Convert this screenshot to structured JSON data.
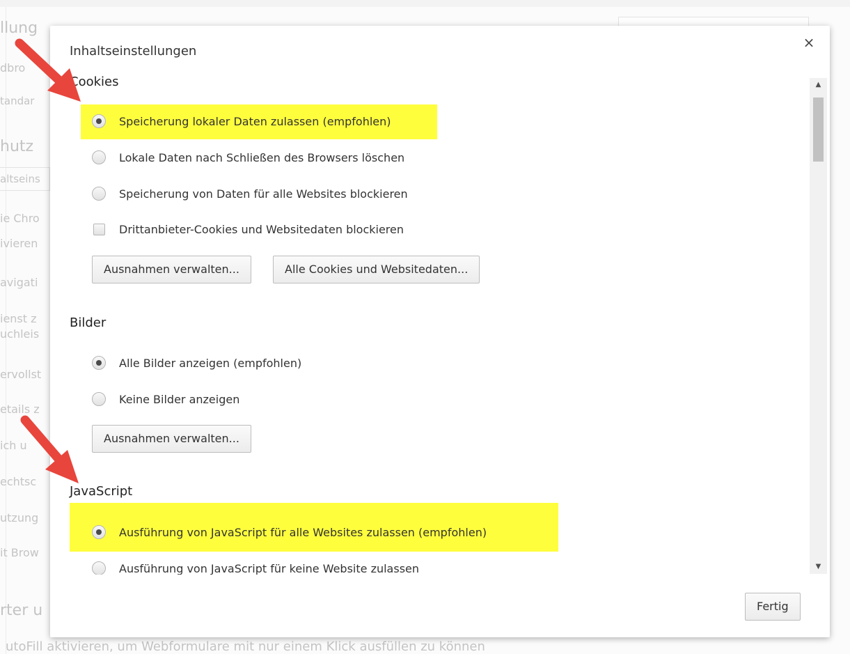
{
  "background": {
    "fragments": [
      "llung",
      "dbro",
      "tandar",
      "hutz",
      "altseins",
      "ie Chro",
      "ivieren",
      "avigati",
      "ienst z",
      "uchleis",
      "ervollst",
      "etails z",
      "ich u",
      "echtsc",
      "utzung",
      "it Brow",
      "rter u"
    ],
    "footer_text": "utoFill aktivieren, um Webformulare mit nur einem Klick ausfüllen zu können"
  },
  "dialog": {
    "title": "Inhaltseinstellungen",
    "close_label": "×",
    "done_label": "Fertig"
  },
  "cookies": {
    "title": "Cookies",
    "options": [
      {
        "label": "Speicherung lokaler Daten zulassen (empfohlen)",
        "checked": true
      },
      {
        "label": "Lokale Daten nach Schließen des Browsers löschen",
        "checked": false
      },
      {
        "label": "Speicherung von Daten für alle Websites blockieren",
        "checked": false
      }
    ],
    "checkbox_label": "Drittanbieter-Cookies und Websitedaten blockieren",
    "checkbox_checked": false,
    "manage_exceptions_label": "Ausnahmen verwalten...",
    "all_cookies_label": "Alle Cookies und Websitedaten..."
  },
  "images": {
    "title": "Bilder",
    "options": [
      {
        "label": "Alle Bilder anzeigen (empfohlen)",
        "checked": true
      },
      {
        "label": "Keine Bilder anzeigen",
        "checked": false
      }
    ],
    "manage_exceptions_label": "Ausnahmen verwalten..."
  },
  "javascript": {
    "title": "JavaScript",
    "options": [
      {
        "label": "Ausführung von JavaScript für alle Websites zulassen (empfohlen)",
        "checked": true
      },
      {
        "label": "Ausführung von JavaScript für keine Website zulassen",
        "checked": false
      }
    ]
  },
  "scrollbar": {
    "up_icon": "▲",
    "down_icon": "▼"
  },
  "colors": {
    "highlight": "#fffe3d",
    "arrow": "#e8453c"
  }
}
